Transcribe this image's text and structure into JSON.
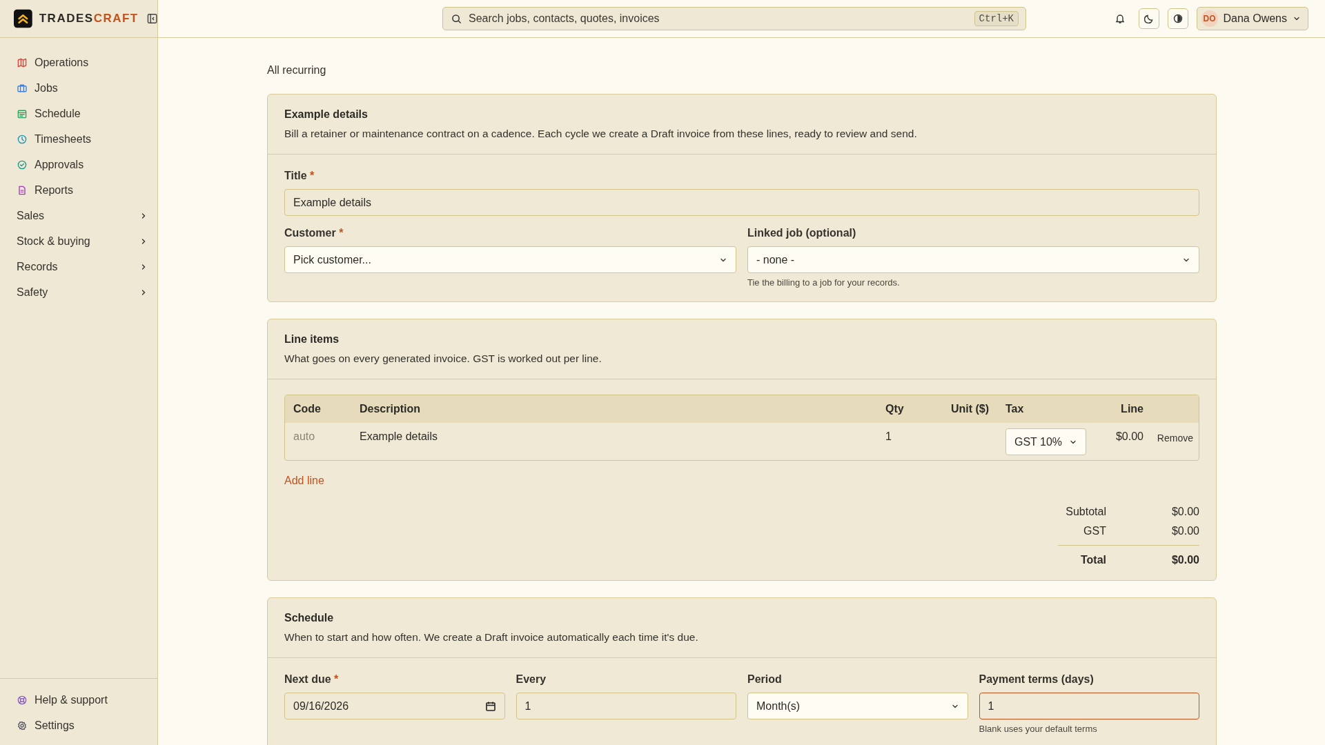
{
  "brand": {
    "part_1": "TRADES",
    "part_2": "CRAFT"
  },
  "search": {
    "placeholder": "Search jobs, contacts, quotes, invoices",
    "shortcut": "Ctrl+K"
  },
  "user": {
    "initials": "DO",
    "name": "Dana Owens"
  },
  "sidebar": {
    "items": [
      {
        "label": "Operations",
        "kind": "link"
      },
      {
        "label": "Jobs",
        "kind": "link"
      },
      {
        "label": "Schedule",
        "kind": "link"
      },
      {
        "label": "Timesheets",
        "kind": "link"
      },
      {
        "label": "Approvals",
        "kind": "link"
      },
      {
        "label": "Reports",
        "kind": "link"
      },
      {
        "label": "Sales",
        "kind": "group",
        "expanded": false
      },
      {
        "label": "Stock & buying",
        "kind": "group",
        "expanded": false
      },
      {
        "label": "Records",
        "kind": "group",
        "expanded": false
      },
      {
        "label": "Safety",
        "kind": "group",
        "expanded": false
      }
    ],
    "footer": [
      {
        "label": "Help & support"
      },
      {
        "label": "Settings"
      }
    ]
  },
  "breadcrumb": "All recurring",
  "details": {
    "title": "Example details",
    "description": "Bill a retainer or maintenance contract on a cadence. Each cycle we create a Draft invoice from these lines, ready to review and send.",
    "rows": [
      [
        {
          "label": "Title",
          "required_mark": "*",
          "kind": "text",
          "value": "Example details",
          "invalid": false
        }
      ],
      [
        {
          "label": "Customer",
          "required_mark": "*",
          "kind": "select",
          "value": "Pick customer...",
          "invalid": false
        },
        {
          "label": "Linked job (optional)",
          "kind": "select",
          "value": "- none -",
          "hint": "Tie the billing to a job for your records.",
          "invalid": false
        }
      ]
    ]
  },
  "line_items": {
    "title": "Line items",
    "description": "What goes on every generated invoice. GST is worked out per line.",
    "columns": [
      {
        "label": "Code"
      },
      {
        "label": "Description"
      },
      {
        "label": "Qty"
      },
      {
        "label": "Unit ($)"
      },
      {
        "label": "Tax"
      },
      {
        "label": "Line"
      }
    ],
    "rows": [
      {
        "code": "auto",
        "description": "Example details",
        "qty": "1",
        "tax": "GST 10%",
        "line": "$0.00",
        "remove": "Remove"
      }
    ],
    "add_line": "Add line",
    "totals": [
      {
        "label": "Subtotal",
        "value": "$0.00",
        "kind": "plain"
      },
      {
        "label": "GST",
        "value": "$0.00",
        "kind": "plain"
      },
      {
        "label": "Total",
        "value": "$0.00",
        "kind": "total"
      }
    ]
  },
  "schedule": {
    "title": "Schedule",
    "description": "When to start and how often. We create a Draft invoice automatically each time it's due.",
    "rows": [
      [
        {
          "label": "Next due",
          "required_mark": "*",
          "kind": "date",
          "value": "09/16/2026",
          "invalid": false
        },
        {
          "label": "Every",
          "kind": "text",
          "value": "1",
          "invalid": false
        },
        {
          "label": "Period",
          "kind": "select",
          "value": "Month(s)",
          "invalid": false
        },
        {
          "label": "Payment terms (days)",
          "kind": "text",
          "value": "1",
          "hint": "Blank uses your default terms",
          "invalid": true
        }
      ]
    ]
  }
}
